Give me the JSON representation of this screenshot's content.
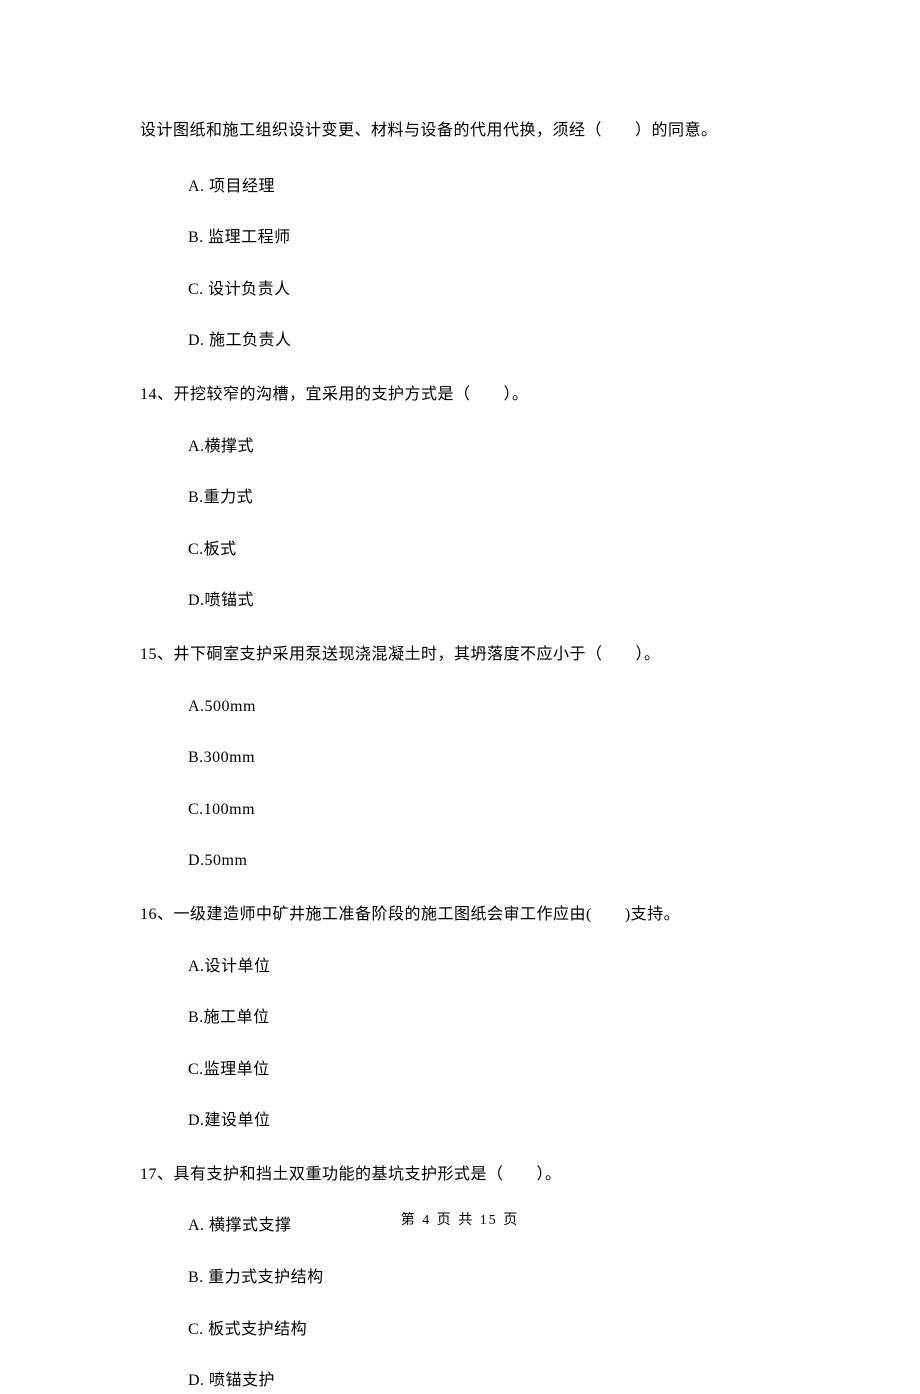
{
  "intro": "设计图纸和施工组织设计变更、材料与设备的代用代换，须经（　　）的同意。",
  "q13_options": {
    "a": "A.  项目经理",
    "b": "B.  监理工程师",
    "c": "C.  设计负责人",
    "d": "D.  施工负责人"
  },
  "q14": {
    "text": "14、开挖较窄的沟槽，宜采用的支护方式是（　　）。",
    "a": "A.横撑式",
    "b": "B.重力式",
    "c": "C.板式",
    "d": "D.喷锚式"
  },
  "q15": {
    "text": "15、井下硐室支护采用泵送现浇混凝土时，其坍落度不应小于（　　）。",
    "a": "A.500mm",
    "b": "B.300mm",
    "c": "C.100mm",
    "d": "D.50mm"
  },
  "q16": {
    "text": "16、一级建造师中矿井施工准备阶段的施工图纸会审工作应由(　　)支持。",
    "a": "A.设计单位",
    "b": "B.施工单位",
    "c": "C.监理单位",
    "d": "D.建设单位"
  },
  "q17": {
    "text": "17、具有支护和挡土双重功能的基坑支护形式是（　　）。",
    "a": "A.  横撑式支撑",
    "b": "B.  重力式支护结构",
    "c": "C.  板式支护结构",
    "d": "D.  喷锚支护"
  },
  "footer": "第 4 页 共 15 页"
}
